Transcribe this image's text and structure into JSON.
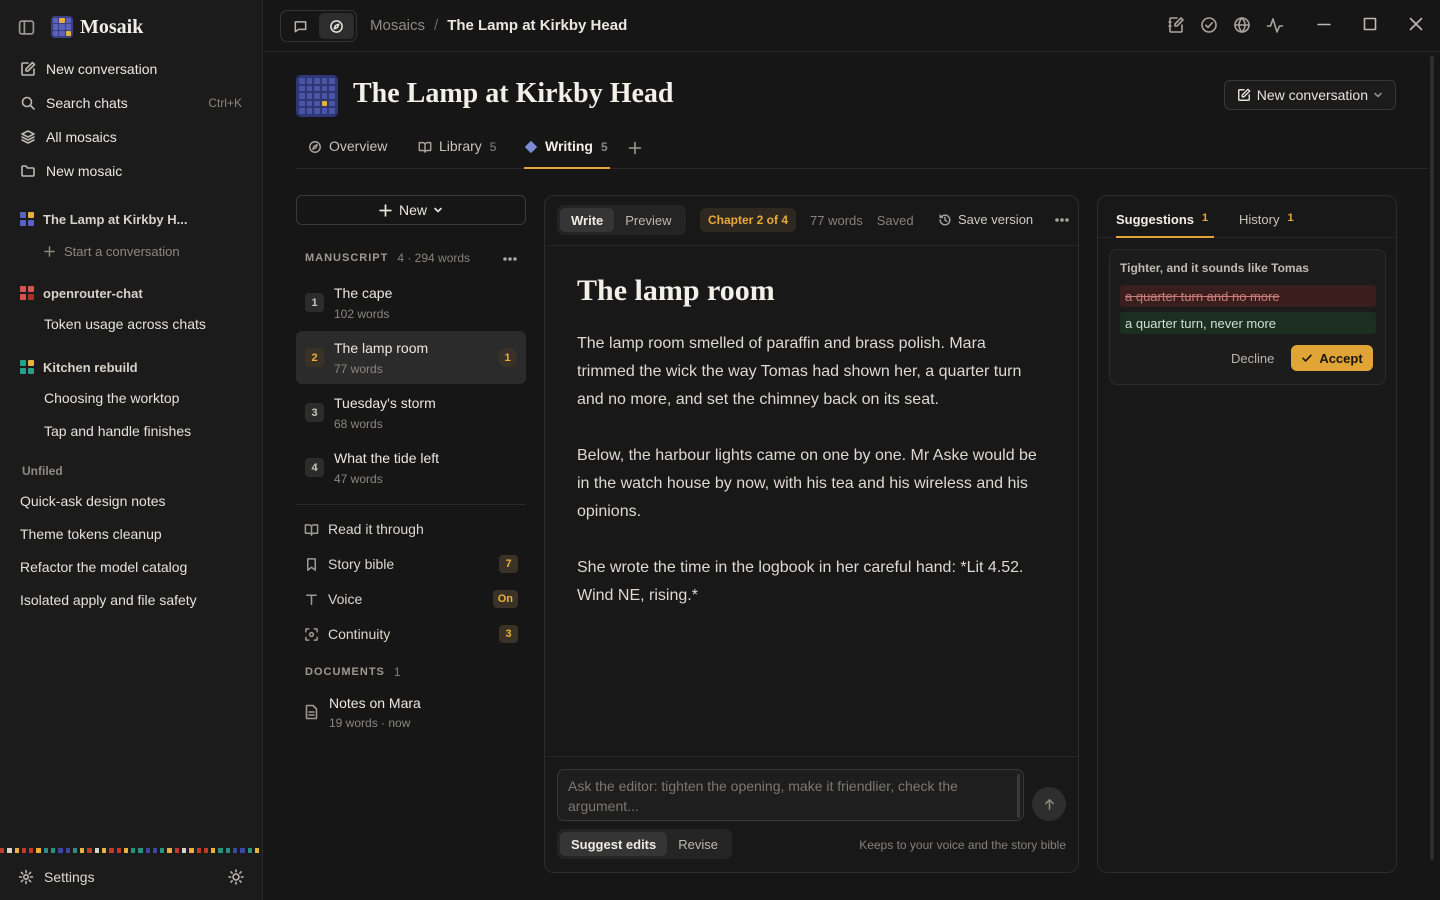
{
  "app": {
    "name": "Mosaik"
  },
  "sidebar": {
    "nav": [
      {
        "label": "New conversation",
        "icon": "compose-icon"
      },
      {
        "label": "Search chats",
        "shortcut": "Ctrl+K",
        "icon": "search-icon"
      },
      {
        "label": "All mosaics",
        "icon": "layers-icon"
      },
      {
        "label": "New mosaic",
        "icon": "folder-icon"
      }
    ],
    "groups": [
      {
        "name": "The Lamp at Kirkby H...",
        "start_label": "Start a conversation",
        "colors": [
          "#5a63c5",
          "#e9b13b",
          "#5a63c5",
          "#5a63c5"
        ]
      },
      {
        "name": "openrouter-chat",
        "items": [
          "Token usage across chats"
        ],
        "colors": [
          "#d9534f",
          "#d9534f",
          "#d9534f",
          "#c0392b"
        ]
      },
      {
        "name": "Kitchen rebuild",
        "items": [
          "Choosing the worktop",
          "Tap and handle finishes"
        ],
        "colors": [
          "#27a28a",
          "#e9b13b",
          "#27a28a",
          "#27a28a"
        ]
      }
    ],
    "unfiled_label": "Unfiled",
    "unfiled": [
      "Quick-ask design notes",
      "Theme tokens cleanup",
      "Refactor the model catalog",
      "Isolated apply and file safety"
    ],
    "settings_label": "Settings"
  },
  "topbar": {
    "breadcrumb": [
      "Mosaics",
      "The Lamp at Kirkby Head"
    ],
    "separator": "/"
  },
  "header": {
    "title": "The Lamp at Kirkby Head",
    "new_conversation": "New conversation",
    "tabs": [
      {
        "label": "Overview",
        "icon": "compass-icon",
        "count": ""
      },
      {
        "label": "Library",
        "icon": "book-icon",
        "count": "5"
      },
      {
        "label": "Writing",
        "icon": "diamond-icon",
        "count": "5"
      }
    ]
  },
  "manuscript": {
    "new_label": "New",
    "section_label": "MANUSCRIPT",
    "section_meta": "4 · 294 words",
    "chapters": [
      {
        "num": "1",
        "title": "The cape",
        "words": "102 words",
        "badge": ""
      },
      {
        "num": "2",
        "title": "The lamp room",
        "words": "77 words",
        "badge": "1"
      },
      {
        "num": "3",
        "title": "Tuesday's storm",
        "words": "68 words",
        "badge": ""
      },
      {
        "num": "4",
        "title": "What the tide left",
        "words": "47 words",
        "badge": ""
      }
    ],
    "tools": [
      {
        "label": "Read it through",
        "pill": ""
      },
      {
        "label": "Story bible",
        "pill": "7"
      },
      {
        "label": "Voice",
        "pill": "On"
      },
      {
        "label": "Continuity",
        "pill": "3"
      }
    ],
    "documents_label": "DOCUMENTS",
    "documents_count": "1",
    "documents": [
      {
        "title": "Notes on Mara",
        "meta": "19 words · now"
      }
    ]
  },
  "editor": {
    "modes": [
      "Write",
      "Preview"
    ],
    "chapter_pill": "Chapter 2 of 4",
    "word_count": "77 words",
    "save_status": "Saved",
    "save_version": "Save version",
    "heading": "The lamp room",
    "paragraphs": [
      "The lamp room smelled of paraffin and brass polish. Mara trimmed the wick the way Tomas had shown her, a quarter turn and no more, and set the chimney back on its seat.",
      "Below, the harbour lights came on one by one. Mr Aske would be in the watch house by now, with his tea and his wireless and his opinions.",
      "She wrote the time in the logbook in her careful hand: *Lit 4.52. Wind NE, rising.*"
    ],
    "ask_placeholder": "Ask the editor: tighten the opening, make it friendlier, check the argument...",
    "edit_modes": [
      "Suggest edits",
      "Revise"
    ],
    "footer_note": "Keeps to your voice and the story bible"
  },
  "suggestions": {
    "tabs": [
      {
        "label": "Suggestions",
        "count": "1"
      },
      {
        "label": "History",
        "count": "1"
      }
    ],
    "card": {
      "note": "Tighter, and it sounds like Tomas",
      "removed": "a quarter turn and no more",
      "added": "a quarter turn, never more",
      "decline": "Decline",
      "accept": "Accept"
    }
  },
  "colors": {
    "accent": "#e2a53a",
    "brand": "#4a55a8"
  }
}
